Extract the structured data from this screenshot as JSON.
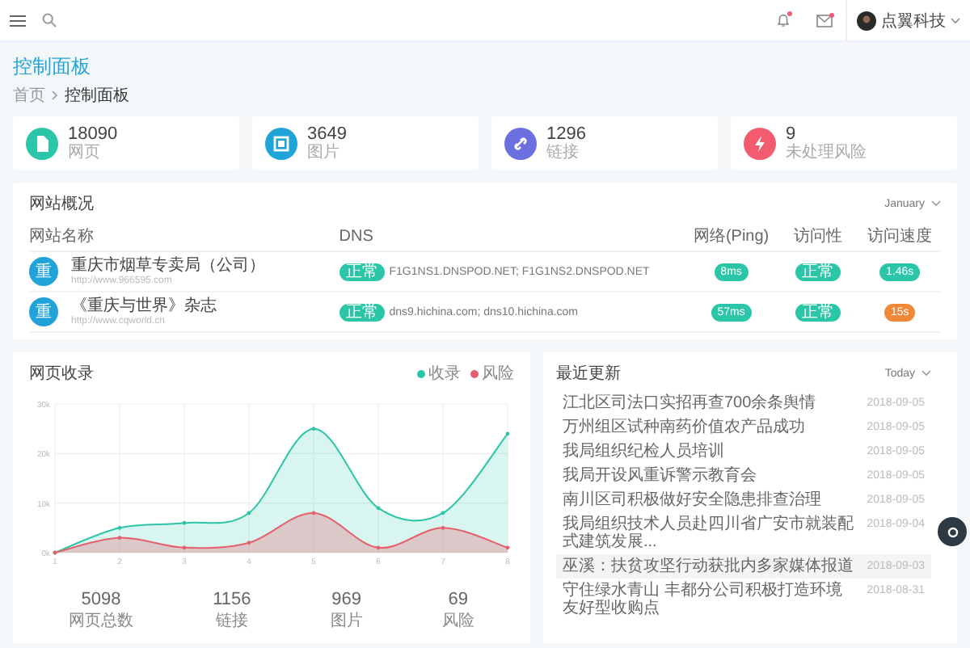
{
  "header": {
    "user_name": "点翼科技",
    "notifications_unread": true,
    "messages_unread": true
  },
  "page": {
    "title": "控制面板",
    "breadcrumb": [
      "首页",
      "控制面板"
    ]
  },
  "stats": [
    {
      "value": "18090",
      "label": "网页",
      "color": "#2bc6a7",
      "kind": "page"
    },
    {
      "value": "3649",
      "label": "图片",
      "color": "#1fa3d9",
      "kind": "image"
    },
    {
      "value": "1296",
      "label": "链接",
      "color": "#6b6fe0",
      "kind": "link"
    },
    {
      "value": "9",
      "label": "未处理风险",
      "color": "#f25c6e",
      "kind": "alert"
    }
  ],
  "overview": {
    "title": "网站概况",
    "period": "January",
    "columns": [
      "网站名称",
      "DNS",
      "网络(Ping)",
      "访问性",
      "访问速度"
    ],
    "rows": [
      {
        "avatar": "重",
        "name": "重庆市烟草专卖局（公司）",
        "url": "http://www.966595.com",
        "dns_status": "正常",
        "dns": "F1G1NS1.DNSPOD.NET; F1G1NS2.DNSPOD.NET",
        "ping": "8ms",
        "access": "正常",
        "speed": "1.46s",
        "speed_slow": false
      },
      {
        "avatar": "重",
        "name": "《重庆与世界》杂志",
        "url": "http://www.cqworld.cn",
        "dns_status": "正常",
        "dns": "dns9.hichina.com; dns10.hichina.com",
        "ping": "57ms",
        "access": "正常",
        "speed": "15s",
        "speed_slow": true
      }
    ]
  },
  "collection": {
    "title": "网页收录",
    "chart_data": {
      "type": "area",
      "grid": true,
      "x": [
        "1",
        "2",
        "3",
        "4",
        "5",
        "6",
        "7",
        "8"
      ],
      "ylim": [
        0,
        30000
      ],
      "yticks": [
        {
          "value": 0,
          "label": "0k"
        },
        {
          "value": 10000,
          "label": "10k"
        },
        {
          "value": 20000,
          "label": "20k"
        },
        {
          "value": 30000,
          "label": "30k"
        }
      ],
      "series": [
        {
          "name": "收录",
          "color": "#2bc6a7",
          "values": [
            0,
            5000,
            6000,
            8000,
            25000,
            9000,
            8000,
            24000
          ]
        },
        {
          "name": "风险",
          "color": "#e4606d",
          "values": [
            0,
            3000,
            1000,
            2000,
            8000,
            1000,
            5000,
            1000
          ]
        }
      ]
    },
    "totals": [
      {
        "value": "5098",
        "label": "网页总数"
      },
      {
        "value": "1156",
        "label": "链接"
      },
      {
        "value": "969",
        "label": "图片"
      },
      {
        "value": "69",
        "label": "风险"
      }
    ]
  },
  "updates": {
    "title": "最近更新",
    "period": "Today",
    "items": [
      {
        "text": "江北区司法口实招再查700余条舆情",
        "date": "2018-09-05",
        "selected": false
      },
      {
        "text": "万州组区试种南药价值农产品成功",
        "date": "2018-09-05",
        "selected": false
      },
      {
        "text": "我局组织纪检人员培训",
        "date": "2018-09-05",
        "selected": false
      },
      {
        "text": "我局开设风重诉警示教育会",
        "date": "2018-09-05",
        "selected": false
      },
      {
        "text": "南川区司积极做好安全隐患排查治理",
        "date": "2018-09-05",
        "selected": false
      },
      {
        "text": "我局组织技术人员赴四川省广安市就装配式建筑发展...",
        "date": "2018-09-04",
        "selected": false
      },
      {
        "text": "巫溪：扶贫攻坚行动获批内多家媒体报道",
        "date": "2018-09-03",
        "selected": true
      },
      {
        "text": "守住绿水青山 丰都分公司积极打造环境友好型收购点",
        "date": "2018-08-31",
        "selected": false
      }
    ]
  }
}
